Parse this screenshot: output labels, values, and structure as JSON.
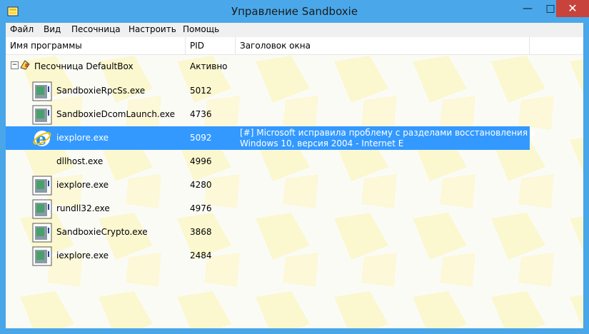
{
  "window": {
    "title": "Управление Sandboxie"
  },
  "window_controls": {
    "minimize": "—",
    "maximize": "□",
    "close": "✕"
  },
  "menu": [
    "Файл",
    "Вид",
    "Песочница",
    "Настроить",
    "Помощь"
  ],
  "columns": {
    "name": "Имя программы",
    "pid": "PID",
    "window_title": "Заголовок окна"
  },
  "sandbox": {
    "name": "Песочница DefaultBox",
    "status": "Активно"
  },
  "processes": [
    {
      "name": "SandboxieRpcSs.exe",
      "pid": "5012",
      "title_line1": "",
      "title_line2": "",
      "icon": "generic-exe-icon"
    },
    {
      "name": "SandboxieDcomLaunch.exe",
      "pid": "4736",
      "title_line1": "",
      "title_line2": "",
      "icon": "generic-exe-icon"
    },
    {
      "name": "iexplore.exe",
      "pid": "5092",
      "title_line1": "[#] Microsoft исправила проблему с разделами восстановления в",
      "title_line2": "Windows 10, версия 2004 - Internet E",
      "icon": "internet-explorer-icon",
      "selected": true
    },
    {
      "name": "dllhost.exe",
      "pid": "4996",
      "title_line1": "",
      "title_line2": "",
      "icon": "none"
    },
    {
      "name": "iexplore.exe",
      "pid": "4280",
      "title_line1": "",
      "title_line2": "",
      "icon": "generic-exe-icon"
    },
    {
      "name": "rundll32.exe",
      "pid": "4976",
      "title_line1": "",
      "title_line2": "",
      "icon": "generic-exe-icon"
    },
    {
      "name": "SandboxieCrypto.exe",
      "pid": "3868",
      "title_line1": "",
      "title_line2": "",
      "icon": "generic-exe-icon"
    },
    {
      "name": "iexplore.exe",
      "pid": "2484",
      "title_line1": "",
      "title_line2": "",
      "icon": "generic-exe-icon"
    }
  ],
  "colors": {
    "titlebar": "#4aa8ea",
    "close": "#c7433c",
    "selection": "#3399ff",
    "pattern": "#fbf7cf"
  }
}
